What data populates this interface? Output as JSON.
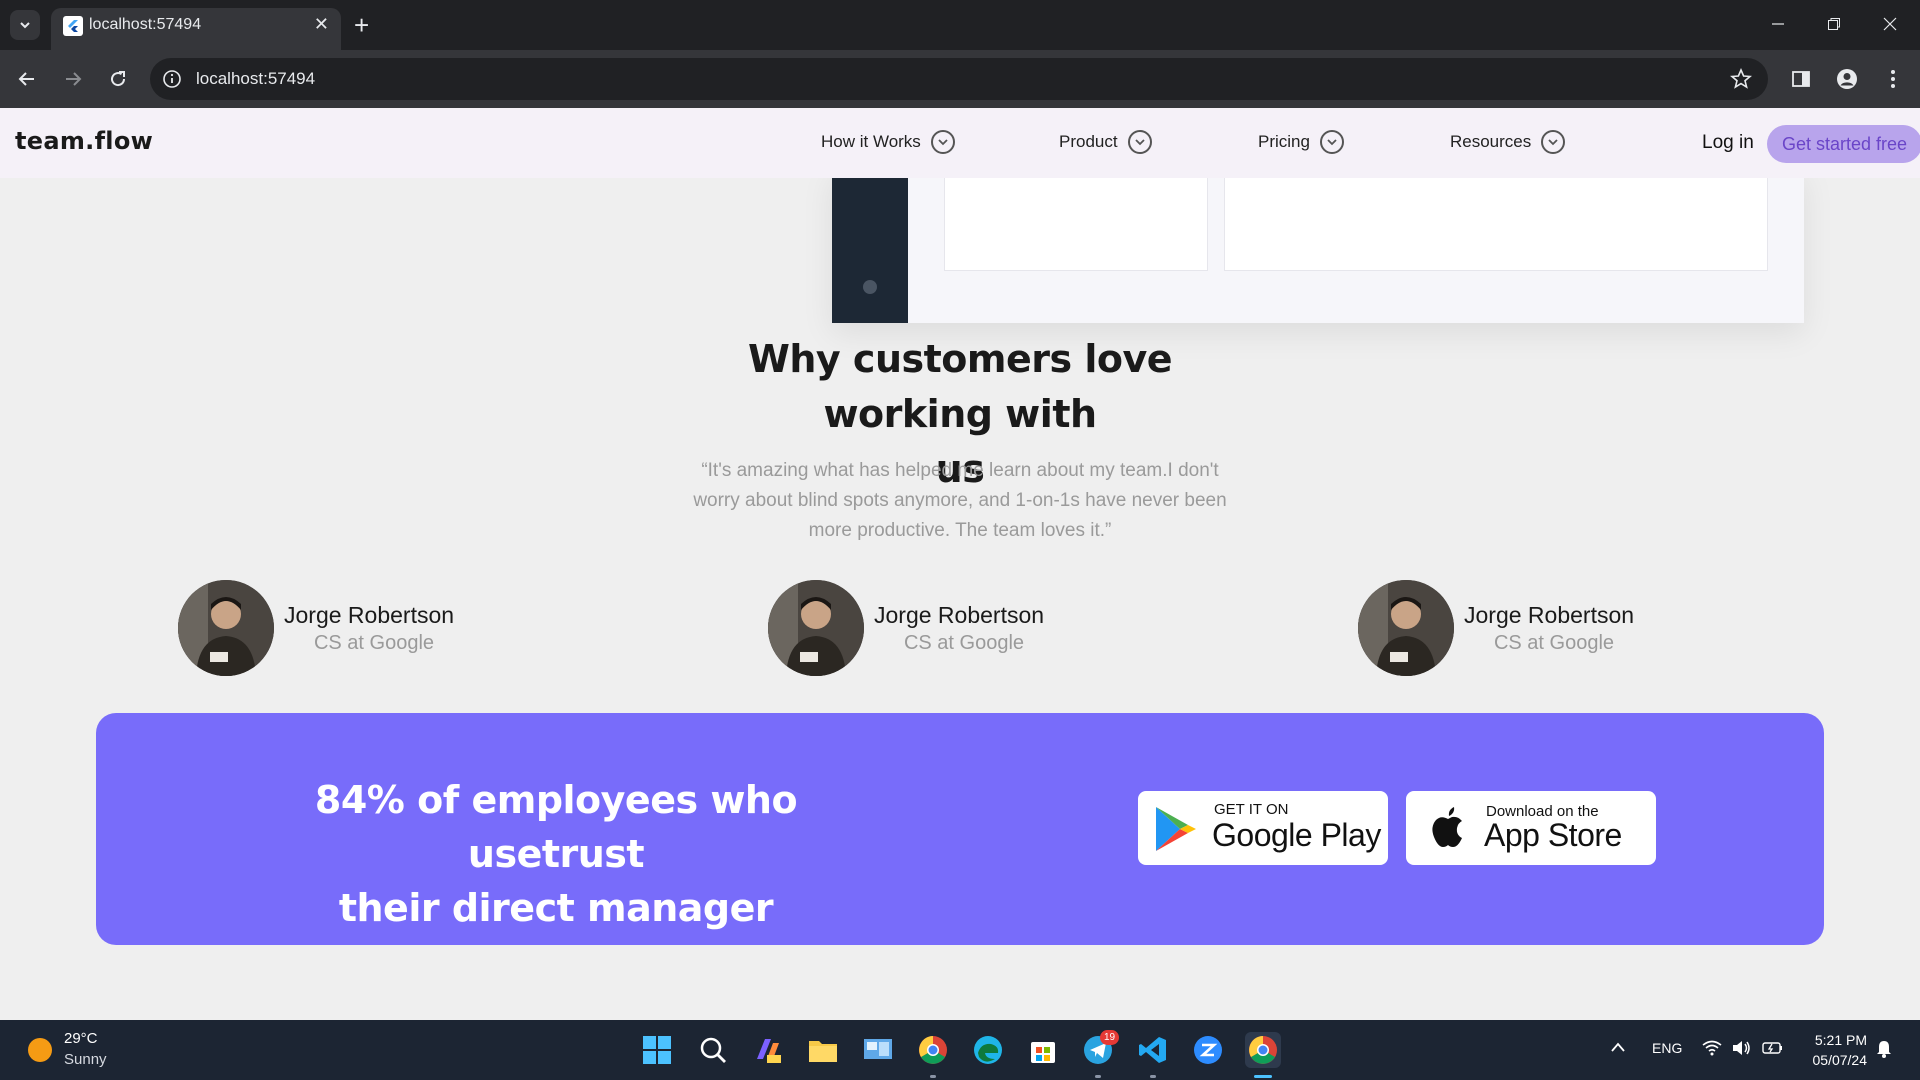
{
  "browser": {
    "tab_title": "localhost:57494",
    "url": "localhost:57494"
  },
  "site": {
    "logo": "team.flow",
    "nav": [
      {
        "label": "How it Works"
      },
      {
        "label": "Product"
      },
      {
        "label": "Pricing"
      },
      {
        "label": "Resources"
      }
    ],
    "login": "Log in",
    "cta": "Get started free"
  },
  "testimonials": {
    "heading_line1": "Why customers love working with",
    "heading_line2": "us",
    "quote_line1": "“It's amazing what has helped me learn about my team.I don't",
    "quote_line2": "worry about blind spots anymore, and 1-on-1s have never been",
    "quote_line3": "more productive. The team loves it.”",
    "people": [
      {
        "name": "Jorge Robertson",
        "role": "CS at Google"
      },
      {
        "name": "Jorge Robertson",
        "role": "CS at Google"
      },
      {
        "name": "Jorge Robertson",
        "role": "CS at Google"
      }
    ]
  },
  "banner": {
    "line1": "84% of employees who usetrust",
    "line2": "their direct manager",
    "google_small": "GET IT ON",
    "google_big": "Google Play",
    "apple_small": "Download on the",
    "apple_big": "App Store",
    "color": "#786cfa"
  },
  "taskbar": {
    "temperature": "29°C",
    "condition": "Sunny",
    "telegram_badge": "19",
    "lang": "ENG",
    "time": "5:21 PM",
    "date": "05/07/24"
  }
}
